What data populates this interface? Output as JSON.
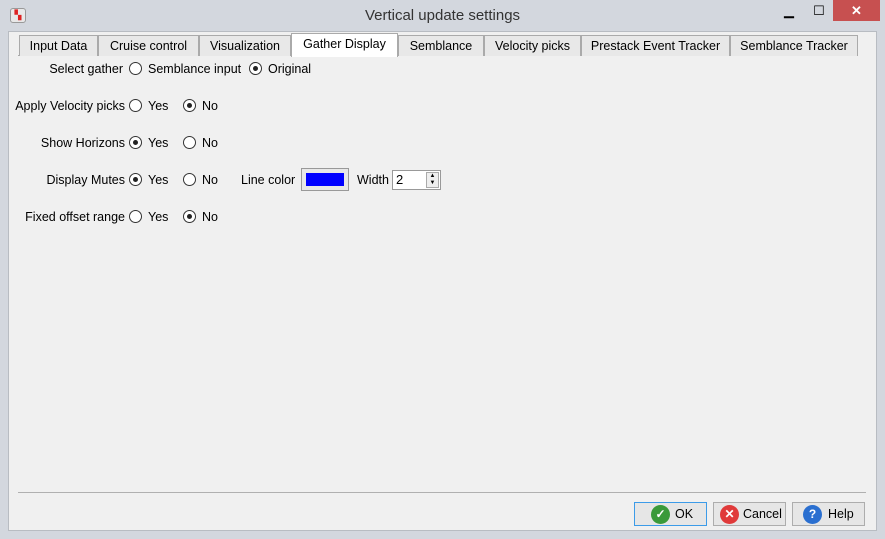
{
  "window": {
    "title": "Vertical update settings",
    "minimize": "▁",
    "maximize": "☐",
    "close": "✕"
  },
  "tabs": [
    {
      "label": "Input Data"
    },
    {
      "label": "Cruise control"
    },
    {
      "label": "Visualization"
    },
    {
      "label": "Gather Display",
      "selected": true
    },
    {
      "label": "Semblance"
    },
    {
      "label": "Velocity picks"
    },
    {
      "label": "Prestack Event Tracker"
    },
    {
      "label": "Semblance Tracker"
    }
  ],
  "form": {
    "select_gather": {
      "label": "Select gather",
      "opt1": "Semblance input",
      "opt2": "Original",
      "selected": "Original"
    },
    "apply_velocity": {
      "label": "Apply Velocity picks",
      "yes": "Yes",
      "no": "No",
      "selected": "No"
    },
    "show_horizons": {
      "label": "Show Horizons",
      "yes": "Yes",
      "no": "No",
      "selected": "Yes"
    },
    "display_mutes": {
      "label": "Display Mutes",
      "yes": "Yes",
      "no": "No",
      "selected": "Yes",
      "line_color_label": "Line color",
      "line_color": "#0000ff",
      "width_label": "Width",
      "width_value": "2"
    },
    "fixed_offset": {
      "label": "Fixed offset range",
      "yes": "Yes",
      "no": "No",
      "selected": "No"
    }
  },
  "buttons": {
    "ok": "OK",
    "cancel": "Cancel",
    "help": "Help"
  }
}
